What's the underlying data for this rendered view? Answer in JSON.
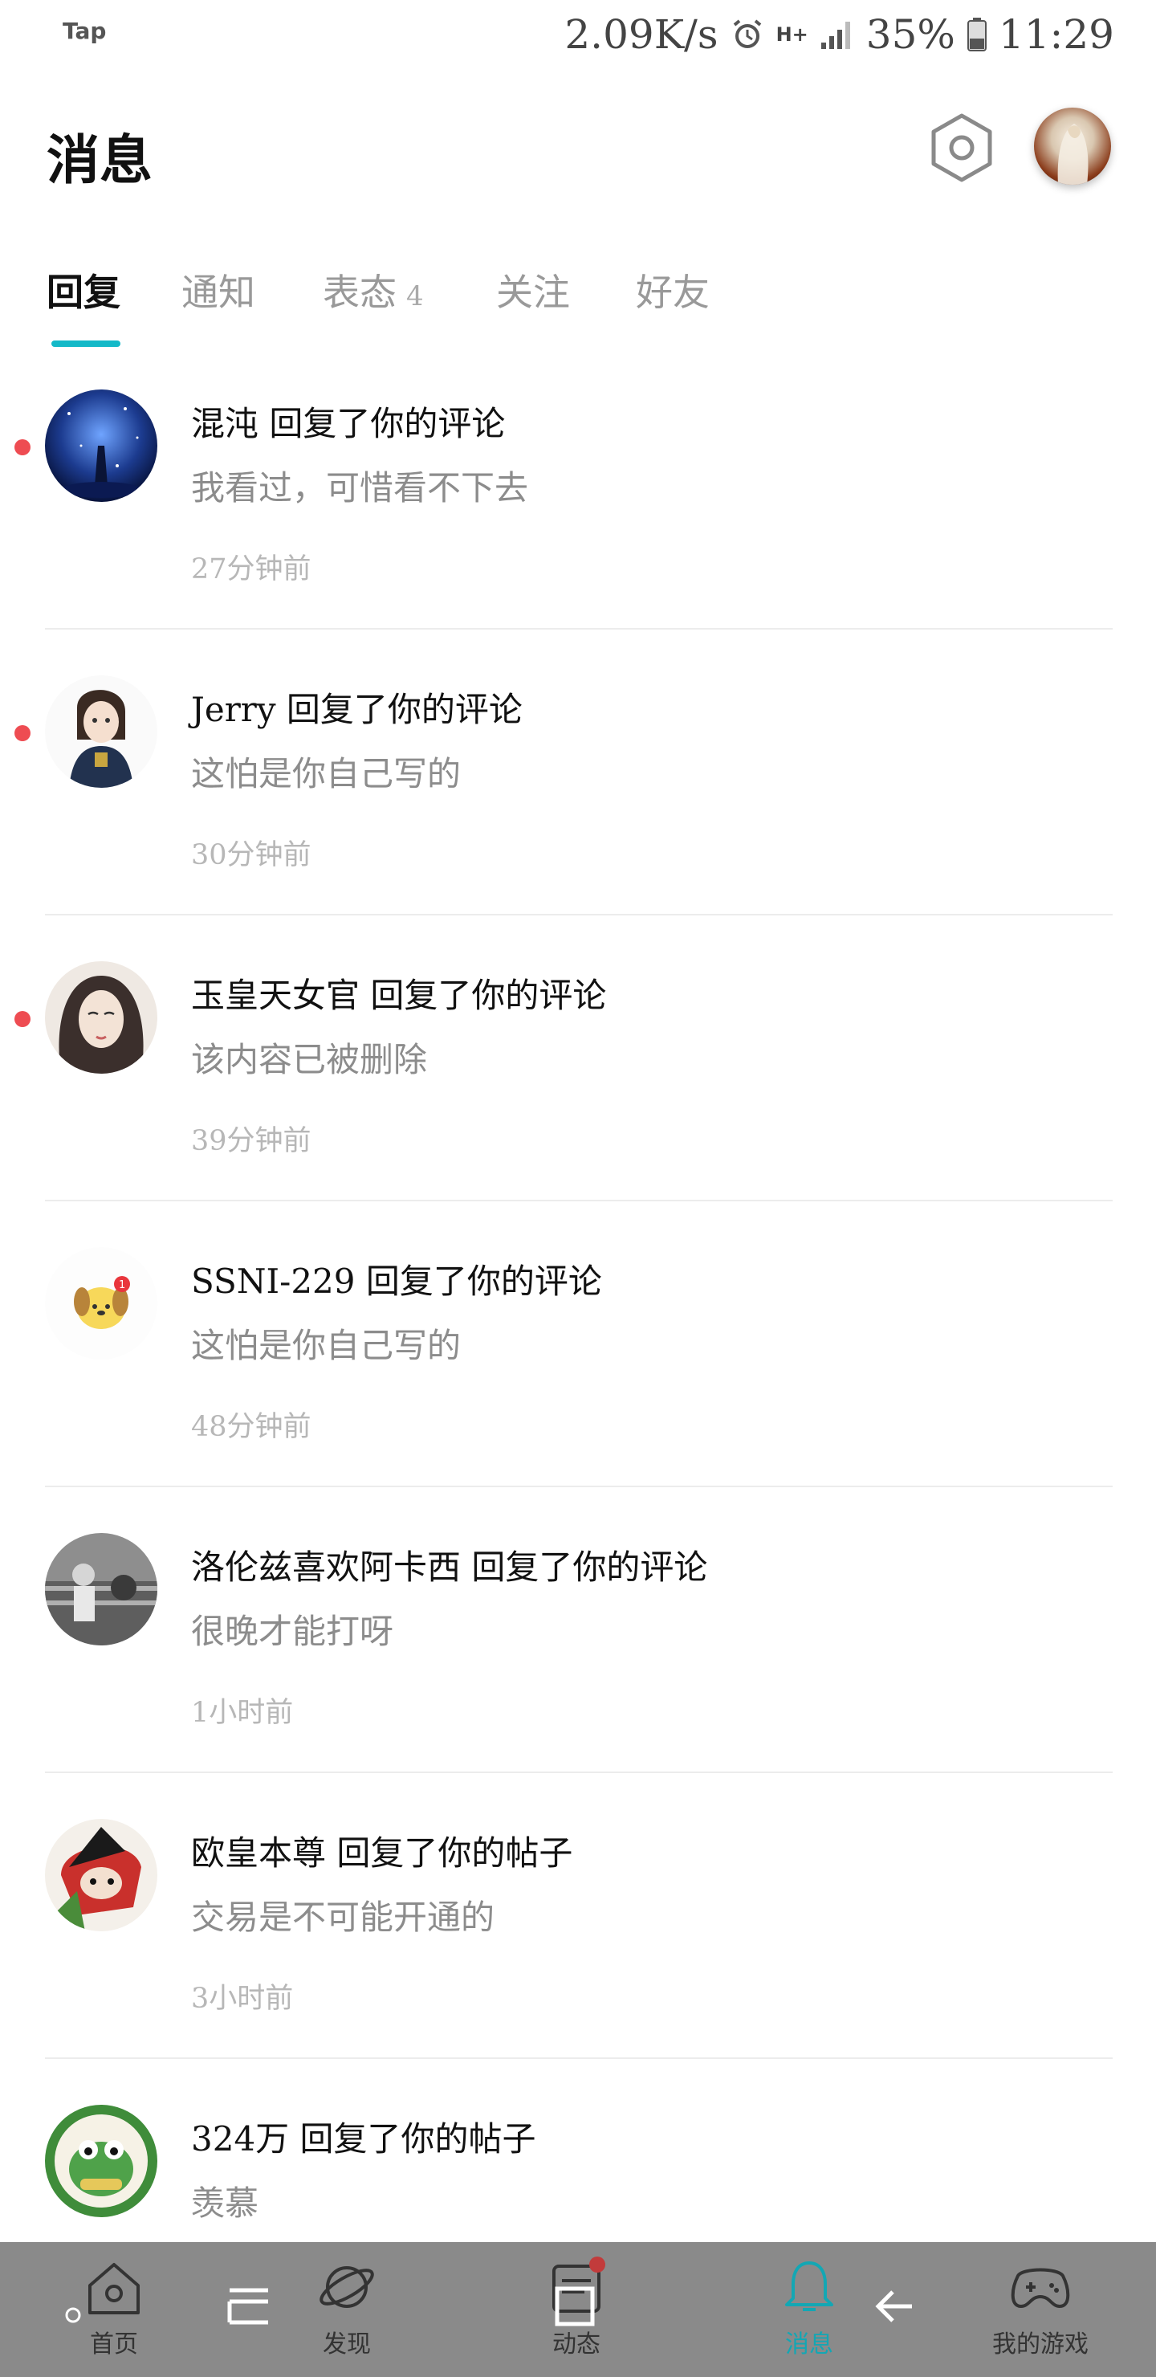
{
  "status_bar": {
    "app_label": "Tap",
    "net_speed": "2.09K/s",
    "signal_type": "H+",
    "battery": "35%",
    "time": "11:29"
  },
  "header": {
    "title": "消息"
  },
  "tabs": [
    {
      "label": "回复",
      "active": true,
      "badge": ""
    },
    {
      "label": "通知",
      "active": false,
      "badge": ""
    },
    {
      "label": "表态",
      "active": false,
      "badge": "4"
    },
    {
      "label": "关注",
      "active": false,
      "badge": ""
    },
    {
      "label": "好友",
      "active": false,
      "badge": ""
    }
  ],
  "messages": [
    {
      "title": "混沌 回复了你的评论",
      "content": "我看过，可惜看不下去",
      "time": "27分钟前",
      "unread": true,
      "avatar": "night-sky-avatar"
    },
    {
      "title": "Jerry 回复了你的评论",
      "content": "这怕是你自己写的",
      "time": "30分钟前",
      "unread": true,
      "avatar": "anime-girl-avatar"
    },
    {
      "title": "玉皇天女官 回复了你的评论",
      "content": "该内容已被删除",
      "time": "39分钟前",
      "unread": true,
      "avatar": "painted-lady-avatar"
    },
    {
      "title": "SSNI-229 回复了你的评论",
      "content": "这怕是你自己写的",
      "time": "48分钟前",
      "unread": false,
      "avatar": "cartoon-dog-avatar"
    },
    {
      "title": "洛伦兹喜欢阿卡西 回复了你的评论",
      "content": "很晚才能打呀",
      "time": "1小时前",
      "unread": false,
      "avatar": "bw-photo-avatar"
    },
    {
      "title": "欧皇本尊 回复了你的帖子",
      "content": "交易是不可能开通的",
      "time": "3小时前",
      "unread": false,
      "avatar": "mask-avatar"
    },
    {
      "title": "324万 回复了你的帖子",
      "content": "羡慕",
      "time": "",
      "unread": false,
      "avatar": "green-frog-avatar"
    }
  ],
  "bottom_nav": [
    {
      "label": "首页",
      "icon": "home-icon",
      "active": false
    },
    {
      "label": "发现",
      "icon": "planet-icon",
      "active": false
    },
    {
      "label": "动态",
      "icon": "feed-icon",
      "active": false
    },
    {
      "label": "消息",
      "icon": "bell-icon",
      "active": true
    },
    {
      "label": "我的游戏",
      "icon": "gamepad-icon",
      "active": false
    }
  ],
  "colors": {
    "accent": "#14b9c8",
    "unread_dot": "#ee4c52",
    "nav_background": "#8a8a8a"
  }
}
